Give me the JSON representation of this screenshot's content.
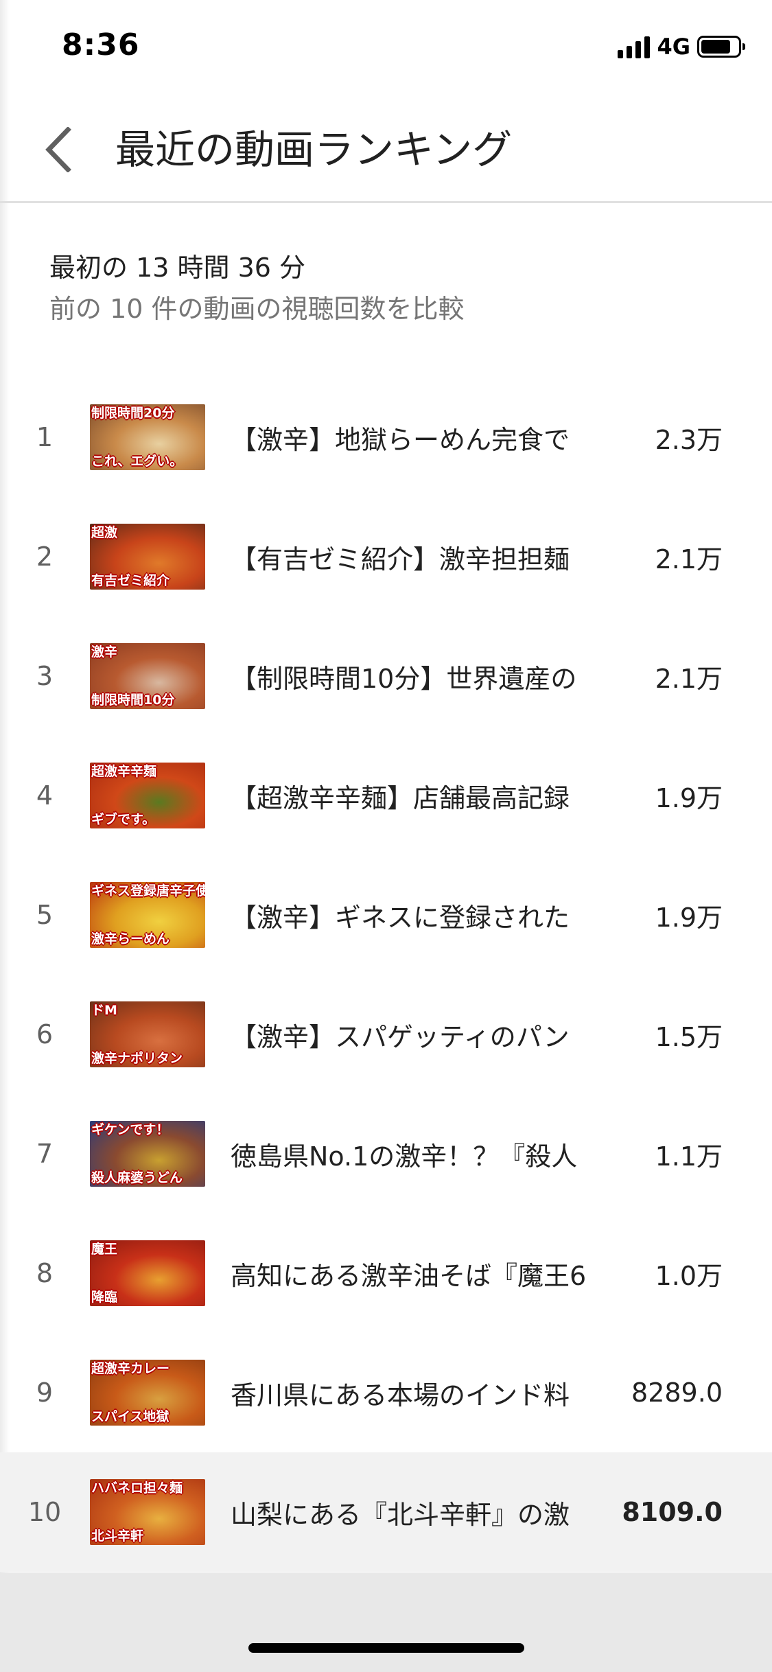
{
  "status_bar": {
    "time": "8:36",
    "network": "4G",
    "battery_level": 0.8
  },
  "header": {
    "title": "最近の動画ランキング"
  },
  "summary": {
    "line1": "最初の 13 時間 36 分",
    "line2": "前の 10 件の動画の視聴回数を比較"
  },
  "rankings": [
    {
      "rank": "1",
      "title": "【激辛】地獄らーめん完食で",
      "views": "2.3万",
      "thumb_top": "制限時間20分",
      "thumb_bottom": "これ、エグい。",
      "thumb_colors": [
        "#7a4a2a",
        "#c98a4a",
        "#e8d0a0"
      ]
    },
    {
      "rank": "2",
      "title": "【有吉ゼミ紹介】激辛担担麺",
      "views": "2.1万",
      "thumb_top": "超激",
      "thumb_bottom": "有吉ゼミ紹介",
      "thumb_colors": [
        "#5a2a18",
        "#c8441a",
        "#e07a2a"
      ]
    },
    {
      "rank": "3",
      "title": "【制限時間10分】世界遺産の",
      "views": "2.1万",
      "thumb_top": "激辛",
      "thumb_bottom": "制限時間10分",
      "thumb_colors": [
        "#8a3a20",
        "#b85a30",
        "#d8b8a0"
      ]
    },
    {
      "rank": "4",
      "title": "【超激辛辛麺】店舗最高記録",
      "views": "1.9万",
      "thumb_top": "超激辛辛麺",
      "thumb_bottom": "ギブです。",
      "thumb_colors": [
        "#a82a10",
        "#d04818",
        "#5a7a20"
      ]
    },
    {
      "rank": "5",
      "title": "【激辛】ギネスに登録された",
      "views": "1.9万",
      "thumb_top": "ギネス登録唐辛子使用",
      "thumb_bottom": "激辛らーめん",
      "thumb_colors": [
        "#b8300e",
        "#e0a020",
        "#f0d040"
      ]
    },
    {
      "rank": "6",
      "title": "【激辛】スパゲッティのパン",
      "views": "1.5万",
      "thumb_top": "ドM",
      "thumb_bottom": "激辛ナポリタン",
      "thumb_colors": [
        "#6a3018",
        "#b84a20",
        "#d87040"
      ]
    },
    {
      "rank": "7",
      "title": "徳島県No.1の激辛！？『殺人",
      "views": "1.1万",
      "thumb_top": "ギケンです！",
      "thumb_bottom": "殺人麻婆うどん",
      "thumb_colors": [
        "#2a3a7a",
        "#8a4a30",
        "#c8a030"
      ]
    },
    {
      "rank": "8",
      "title": "高知にある激辛油そば『魔王6",
      "views": "1.0万",
      "thumb_top": "魔王",
      "thumb_bottom": "降臨",
      "thumb_colors": [
        "#8a1a10",
        "#c83018",
        "#e8a030"
      ]
    },
    {
      "rank": "9",
      "title": "香川県にある本場のインド料",
      "views": "8289.0",
      "thumb_top": "超激辛カレー",
      "thumb_bottom": "スパイス地獄",
      "thumb_colors": [
        "#8a3a10",
        "#c85a18",
        "#d8a040"
      ]
    },
    {
      "rank": "10",
      "title": "山梨にある『北斗辛軒』の激",
      "views": "8109.0",
      "thumb_top": "ハバネロ担々麺",
      "thumb_bottom": "北斗辛軒",
      "thumb_colors": [
        "#a83010",
        "#d06020",
        "#e8b040"
      ]
    }
  ]
}
